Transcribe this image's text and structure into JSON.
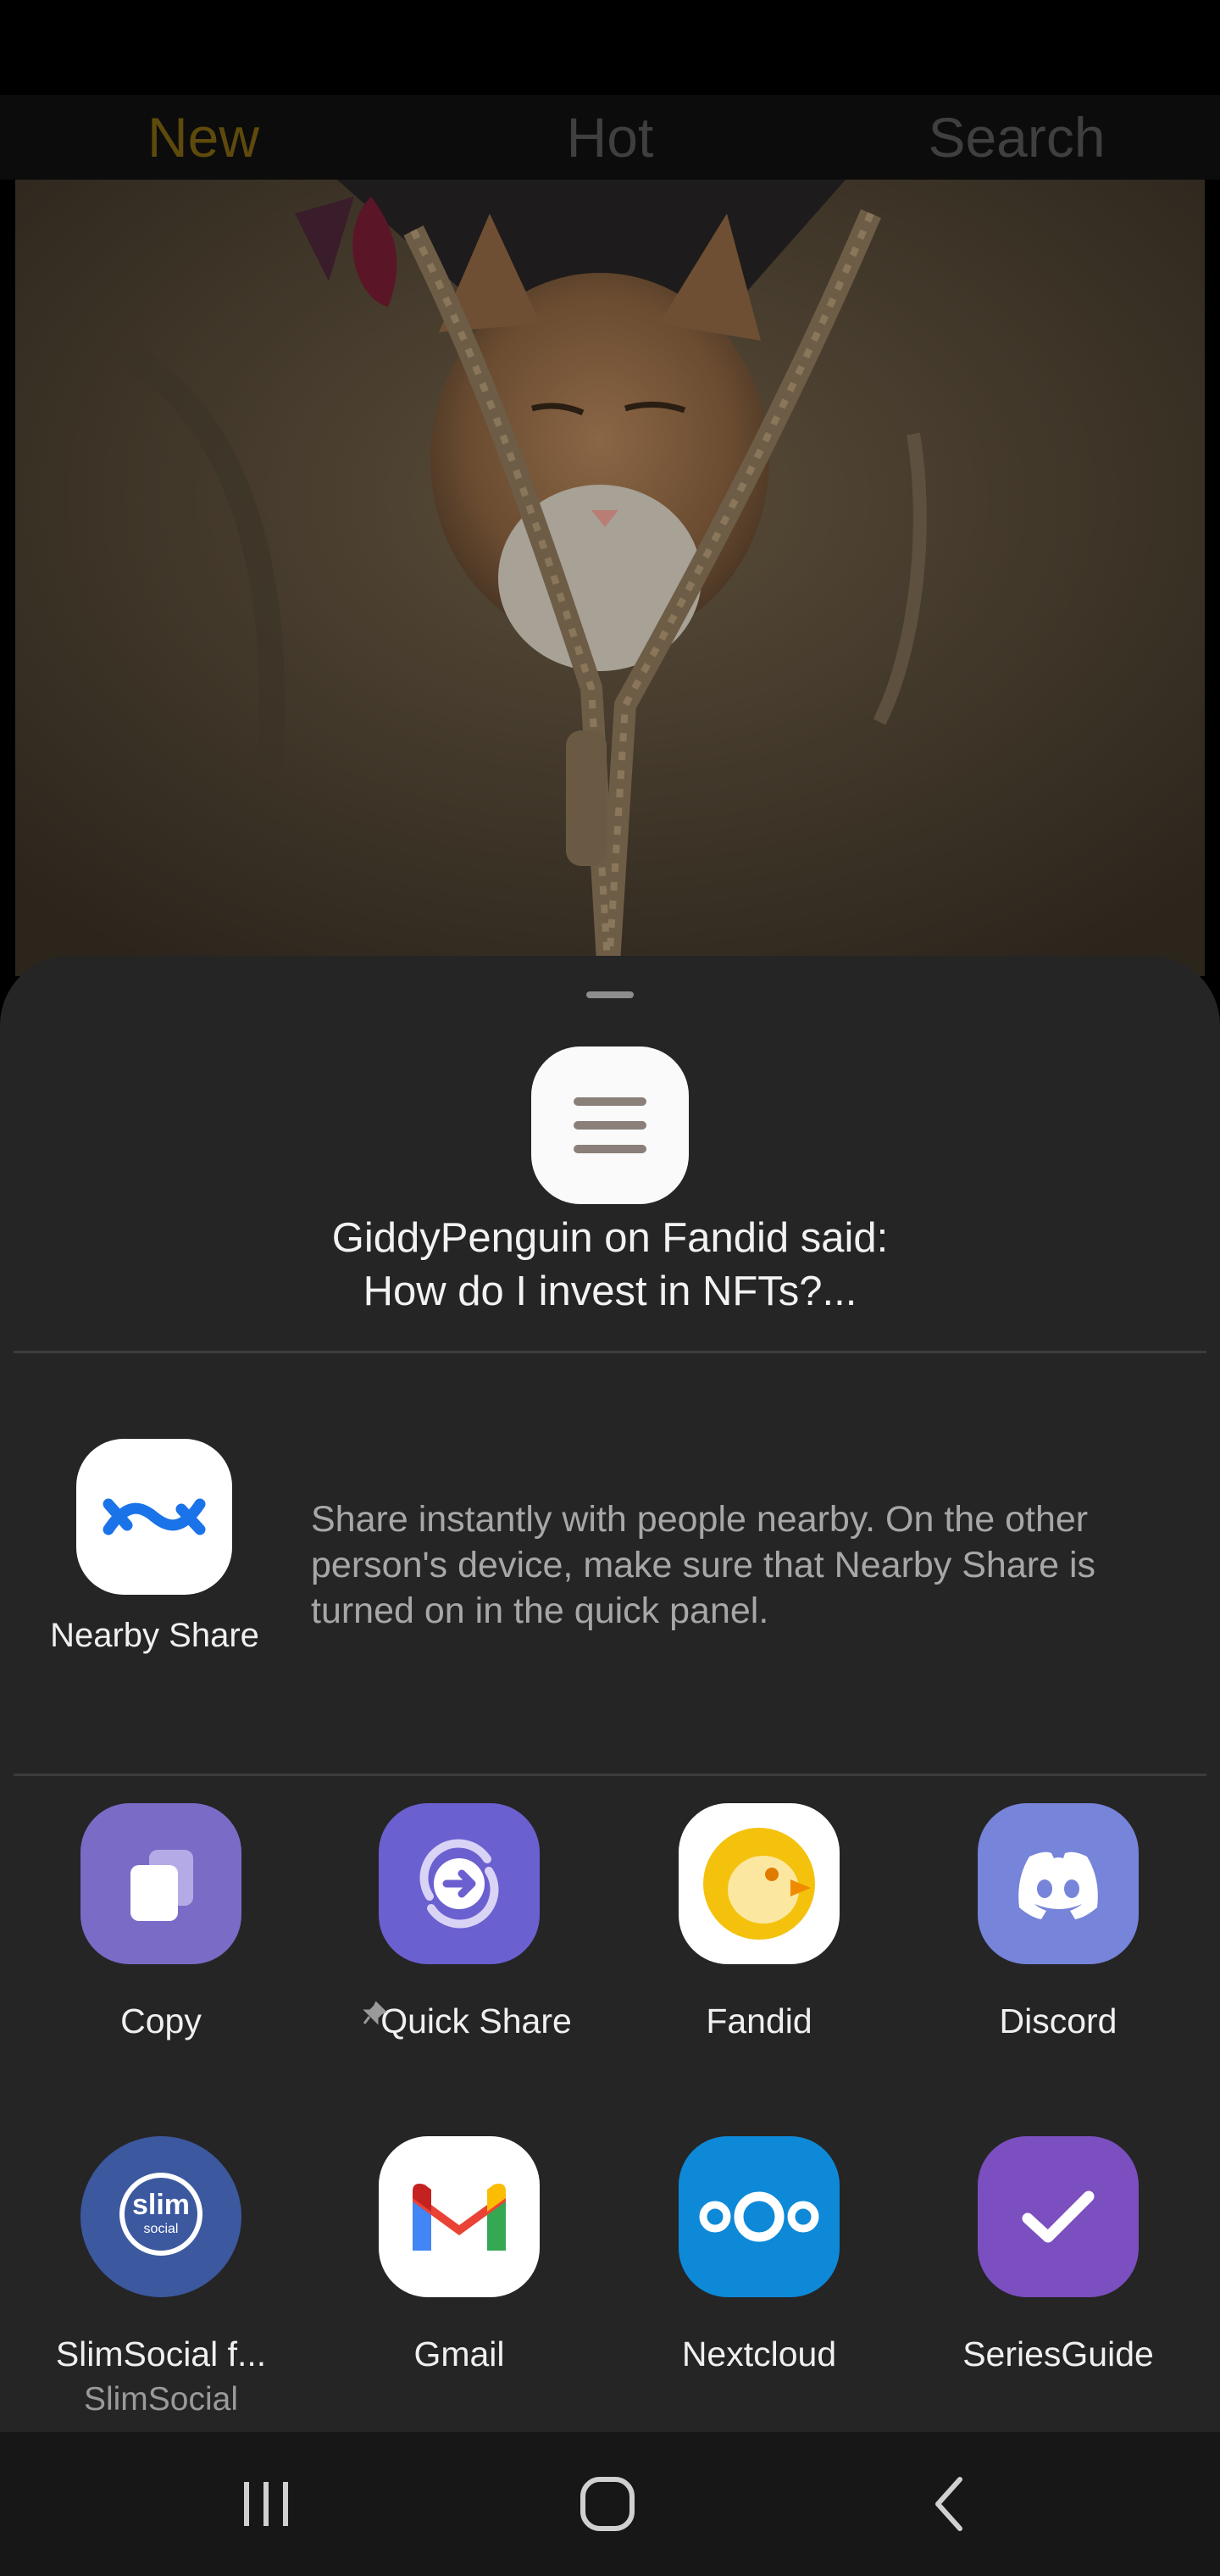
{
  "app_tabs": [
    "New",
    "Hot",
    "Search"
  ],
  "share_preview": {
    "line1": "GiddyPenguin on Fandid said:",
    "line2": "How do I invest in NFTs?..."
  },
  "nearby": {
    "label": "Nearby Share",
    "description": "Share instantly with people nearby. On the other person's device, make sure that Nearby Share is turned on in the quick panel."
  },
  "targets_row1": [
    {
      "label": "Copy",
      "icon": "copy-icon"
    },
    {
      "label": "Quick Share",
      "icon": "quick-share-icon",
      "pinned": true
    },
    {
      "label": "Fandid",
      "icon": "fandid-icon"
    },
    {
      "label": "Discord",
      "icon": "discord-icon"
    }
  ],
  "targets_row2": [
    {
      "label": "SlimSocial f...",
      "sub": "SlimSocial",
      "icon": "slimsocial-icon",
      "logo_text": "slim",
      "logo_sub": "social"
    },
    {
      "label": "Gmail",
      "icon": "gmail-icon"
    },
    {
      "label": "Nextcloud",
      "icon": "nextcloud-icon"
    },
    {
      "label": "SeriesGuide",
      "icon": "seriesguide-icon"
    }
  ],
  "nav": [
    "recent-apps",
    "home",
    "back"
  ],
  "colors": {
    "sheet": "#252525",
    "active_tab": "#5f4a0d",
    "copy_tile": "#7a6bc6",
    "quick_share_tile": "#6b60d0",
    "fandid_yellow": "#f4c20d",
    "discord": "#7684d9",
    "slimsocial": "#3c589f",
    "nextcloud": "#0d89d8",
    "seriesguide": "#7b4fbf"
  }
}
